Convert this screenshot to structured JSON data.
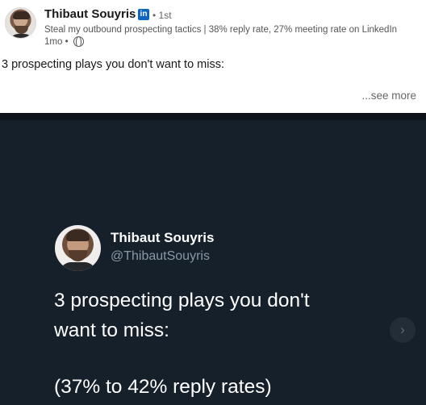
{
  "post": {
    "author_name": "Thibaut Souyris",
    "network_badge": "in",
    "degree": "• 1st",
    "tagline": "Steal my outbound prospecting tactics | 38% reply rate, 27% meeting rate on LinkedIn",
    "time": "1mo •",
    "visibility_icon": "globe-icon",
    "text": "3 prospecting plays you don't want to miss:",
    "see_more": "...see more"
  },
  "media": {
    "tweet_name": "Thibaut Souyris",
    "tweet_handle": "@ThibautSouyris",
    "line1": "3 prospecting plays you don't",
    "line2": "want to miss:",
    "line3": "(37% to 42% reply rates)",
    "next_glyph": "›"
  },
  "colors": {
    "linkedin_blue": "#0a66c2",
    "media_background": "#15202b",
    "tweet_handle": "#8b98a5"
  }
}
